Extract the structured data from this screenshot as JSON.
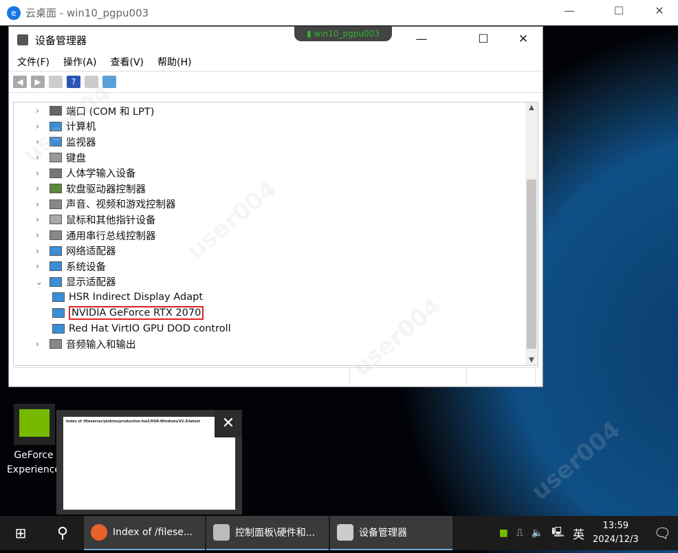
{
  "outer": {
    "title": "云桌面 - win10_pgpu003",
    "min": "—",
    "max": "☐",
    "close": "✕"
  },
  "session_tag": "win10_pgpu003",
  "dm": {
    "title": "设备管理器",
    "min": "—",
    "max": "☐",
    "close": "✕",
    "menu": [
      "文件(F)",
      "操作(A)",
      "查看(V)",
      "帮助(H)"
    ],
    "tree": [
      {
        "label": "端口 (COM 和 LPT)",
        "chevron": ">",
        "color": "#666"
      },
      {
        "label": "计算机",
        "chevron": ">",
        "color": "#3a8fd8"
      },
      {
        "label": "监视器",
        "chevron": ">",
        "color": "#3a8fd8"
      },
      {
        "label": "键盘",
        "chevron": ">",
        "color": "#999"
      },
      {
        "label": "人体学输入设备",
        "chevron": ">",
        "color": "#777"
      },
      {
        "label": "软盘驱动器控制器",
        "chevron": ">",
        "color": "#5a8a3a"
      },
      {
        "label": "声音、视频和游戏控制器",
        "chevron": ">",
        "color": "#888"
      },
      {
        "label": "鼠标和其他指针设备",
        "chevron": ">",
        "color": "#aaa"
      },
      {
        "label": "通用串行总线控制器",
        "chevron": ">",
        "color": "#888"
      },
      {
        "label": "网络适配器",
        "chevron": ">",
        "color": "#3a8fd8"
      },
      {
        "label": "系统设备",
        "chevron": ">",
        "color": "#3a8fd8"
      },
      {
        "label": "显示适配器",
        "chevron": "v",
        "color": "#3a8fd8"
      }
    ],
    "display_children": [
      "HSR Indirect Display Adapt",
      "NVIDIA GeForce RTX 2070",
      "Red Hat VirtIO GPU DOD controll"
    ],
    "after": {
      "label": "音频输入和输出",
      "chevron": ">",
      "color": "#888"
    }
  },
  "desktop": {
    "gfe_label": "GeForce Experience",
    "thumb_title": "Index of /fileserver/jenkins/production-hw2/HSR-Windows/V2.9/latest"
  },
  "taskbar": {
    "tasks": [
      "Index of /filese...",
      "控制面板\\硬件和...",
      "设备管理器"
    ],
    "ime": "英",
    "time": "13:59",
    "date": "2024/12/3"
  },
  "watermark": "user004"
}
